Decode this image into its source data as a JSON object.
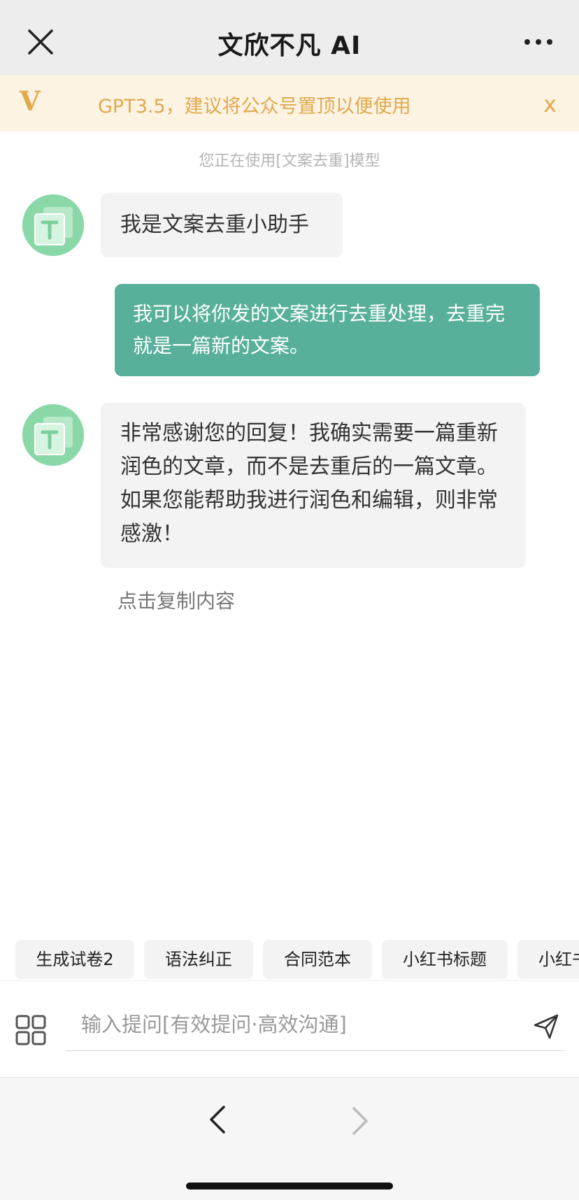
{
  "header": {
    "title": "文欣不凡 AI"
  },
  "banner": {
    "logo_text": "V",
    "text": "GPT3.5，建议将公众号置顶以便使用",
    "close_label": "x"
  },
  "model_hint": "您正在使用[文案去重]模型",
  "messages": [
    {
      "role": "assistant",
      "text": "我是文案去重小助手"
    },
    {
      "role": "user",
      "text": "我可以将你发的文案进行去重处理，去重完就是一篇新的文案。"
    },
    {
      "role": "assistant",
      "text": "非常感谢您的回复！我确实需要一篇重新润色的文章，而不是去重后的一篇文章。如果您能帮助我进行润色和编辑，则非常感激！"
    }
  ],
  "copy_hint": "点击复制内容",
  "quick_chips": [
    "生成试卷2",
    "语法纠正",
    "合同范本",
    "小红书标题",
    "小红书"
  ],
  "input": {
    "placeholder": "输入提问[有效提问·高效沟通]",
    "value": ""
  },
  "colors": {
    "accent": "#58b09a",
    "banner_text": "#e0a94e",
    "banner_bg": "#fdf3e3",
    "avatar": "#8ad8a8"
  },
  "icons": [
    "close-icon",
    "more-icon",
    "app-logo-icon",
    "bot-avatar-icon",
    "grid-icon",
    "send-icon",
    "back-icon",
    "forward-icon"
  ]
}
